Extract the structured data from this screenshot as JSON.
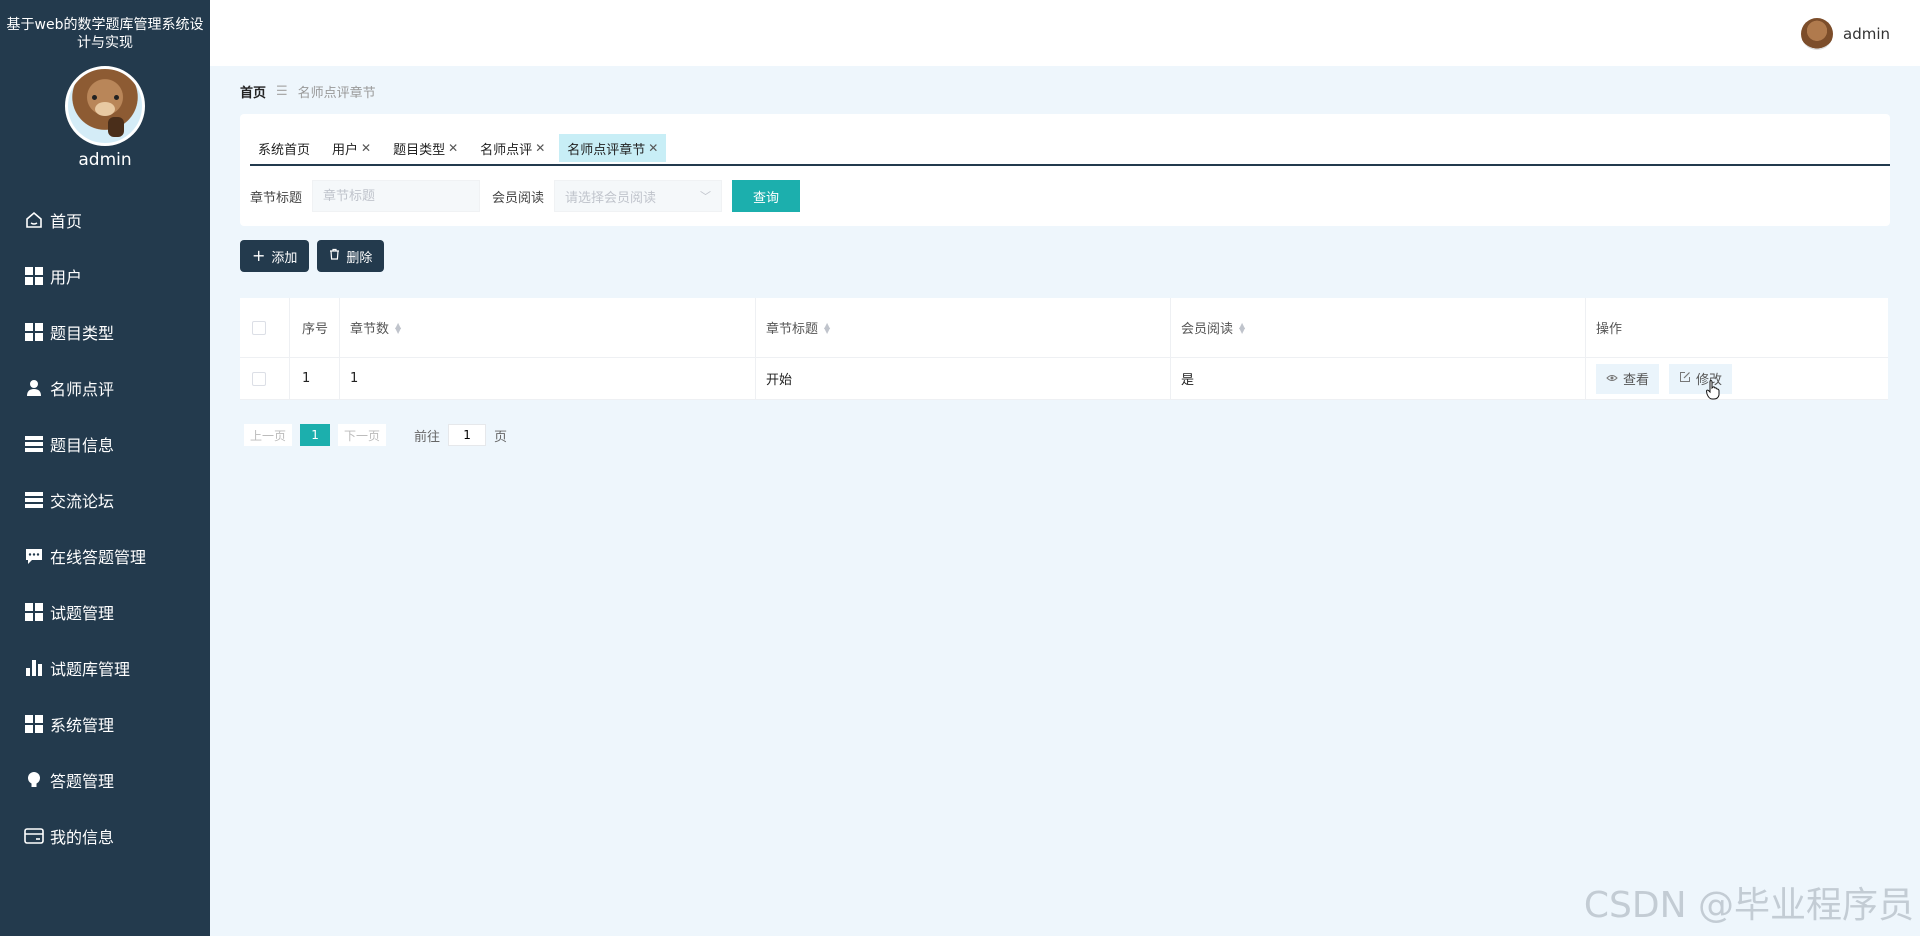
{
  "sidebar": {
    "system_title": "基于web的数学题库管理系统设计与实现",
    "username": "admin",
    "items": [
      {
        "label": "首页",
        "icon": "home-icon"
      },
      {
        "label": "用户",
        "icon": "grid-icon"
      },
      {
        "label": "题目类型",
        "icon": "grid-icon"
      },
      {
        "label": "名师点评",
        "icon": "person-icon"
      },
      {
        "label": "题目信息",
        "icon": "list-icon"
      },
      {
        "label": "交流论坛",
        "icon": "list-icon"
      },
      {
        "label": "在线答题管理",
        "icon": "chat-icon"
      },
      {
        "label": "试题管理",
        "icon": "grid-icon"
      },
      {
        "label": "试题库管理",
        "icon": "bar-chart-icon"
      },
      {
        "label": "系统管理",
        "icon": "grid-icon"
      },
      {
        "label": "答题管理",
        "icon": "bulb-icon"
      },
      {
        "label": "我的信息",
        "icon": "card-icon"
      }
    ]
  },
  "header": {
    "username": "admin"
  },
  "breadcrumb": {
    "home": "首页",
    "current": "名师点评章节"
  },
  "tabs": [
    {
      "label": "系统首页",
      "closable": false
    },
    {
      "label": "用户",
      "closable": true
    },
    {
      "label": "题目类型",
      "closable": true
    },
    {
      "label": "名师点评",
      "closable": true
    },
    {
      "label": "名师点评章节",
      "closable": true,
      "active": true
    }
  ],
  "search": {
    "title_label": "章节标题",
    "title_placeholder": "章节标题",
    "member_label": "会员阅读",
    "member_placeholder": "请选择会员阅读",
    "query_button": "查询"
  },
  "actions": {
    "add": "添加",
    "delete": "删除"
  },
  "table": {
    "headers": [
      "序号",
      "章节数",
      "章节标题",
      "会员阅读",
      "操作"
    ],
    "rows": [
      {
        "index": "1",
        "chapter_no": "1",
        "chapter_title": "开始",
        "member_read": "是"
      }
    ],
    "view_button": "查看",
    "edit_button": "修改"
  },
  "pagination": {
    "prev": "上一页",
    "current": "1",
    "next": "下一页",
    "goto_label": "前往",
    "goto_value": "1",
    "page_suffix": "页"
  },
  "watermark": "CSDN @毕业程序员",
  "colors": {
    "sidebar": "#233a4d",
    "accent": "#1cafad",
    "background": "#eef6fc"
  }
}
